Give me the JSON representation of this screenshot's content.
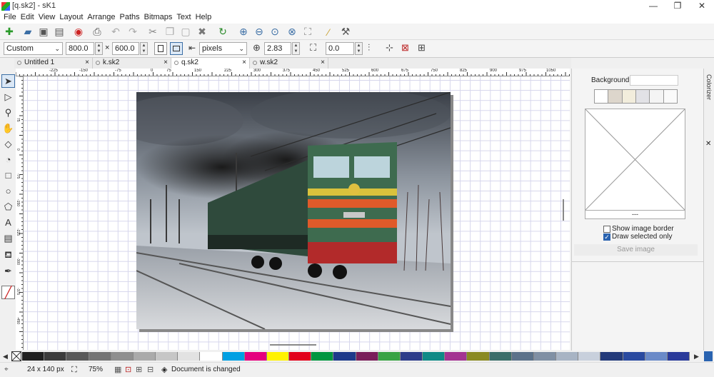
{
  "window": {
    "title": "[q.sk2] - sK1",
    "minimize": "—",
    "maximize": "❐",
    "close": "✕"
  },
  "menu": [
    "File",
    "Edit",
    "View",
    "Layout",
    "Arrange",
    "Paths",
    "Bitmaps",
    "Text",
    "Help"
  ],
  "toolbar": {
    "icons": [
      "new-document-icon",
      "open-folder-icon",
      "save-icon",
      "save-as-icon",
      "close-document-icon",
      "print-icon",
      "undo-icon",
      "redo-icon",
      "cut-icon",
      "copy-icon",
      "paste-icon",
      "delete-icon",
      "refresh-icon",
      "zoom-in-icon",
      "zoom-out-icon",
      "zoom-fit-icon",
      "zoom-selection-icon",
      "zoom-page-icon",
      "wand-icon",
      "pipette-icon"
    ]
  },
  "properties": {
    "page_format": "Custom",
    "width": "800.0",
    "height": "600.0",
    "times": "×",
    "units": "pixels",
    "jump": "2.83",
    "angle": "0.0"
  },
  "tabs": [
    {
      "label": "Untitled 1",
      "close": "×"
    },
    {
      "label": "k.sk2",
      "close": "×"
    },
    {
      "label": "q.sk2",
      "close": "×",
      "active": true
    },
    {
      "label": "w.sk2",
      "close": "×"
    }
  ],
  "ruler_h_ticks": [
    "-225",
    "-150",
    "-75",
    "0",
    "75",
    "150",
    "225",
    "300",
    "375",
    "450",
    "525",
    "600",
    "675",
    "750",
    "825",
    "900",
    "975",
    "1050"
  ],
  "ruler_v_ticks": [
    "75",
    "0",
    "-75",
    "-150",
    "-225",
    "-300",
    "-375",
    "-450",
    "-525",
    "-600",
    "-675"
  ],
  "left_tools": [
    "selection-arrow-icon",
    "node-edit-icon",
    "zoom-tool-icon",
    "fleur-hand-icon",
    "polyline-icon",
    "bezier-icon",
    "rectangle-icon",
    "ellipse-icon",
    "polygon-icon",
    "text-tool-icon",
    "gradient-tool-icon",
    "fill-bucket-icon",
    "pen-outline-icon",
    "no-fill-stroke-icon"
  ],
  "bitmap_panel": {
    "background_label": "Background:",
    "preview_caption": "---",
    "show_border_label": "Show image border",
    "show_border_checked": false,
    "draw_selected_label": "Draw selected only",
    "draw_selected_checked": true,
    "save_button": "Save image"
  },
  "side_tab": {
    "label": "Colorizer"
  },
  "palette": {
    "colors": [
      "#202020",
      "#3c3c3c",
      "#595959",
      "#747474",
      "#8f8f8f",
      "#aaaaaa",
      "#c6c6c6",
      "#e2e2e2",
      "#ffffff",
      "#00a0e3",
      "#e5007e",
      "#fff200",
      "#e2001a",
      "#009640",
      "#1e3a8a",
      "#7a1f5a",
      "#3aa345",
      "#2d3d8a",
      "#0f8a86",
      "#a43492",
      "#8a8a22",
      "#3b6e6a",
      "#5c728a",
      "#8090a4",
      "#a8b4c4",
      "#c8d0dc",
      "#233a7a",
      "#2a4aa0",
      "#6a8ac8",
      "#2a3a9a"
    ]
  },
  "status": {
    "dimensions": "24 x 140 px",
    "zoom": "75%",
    "message": "Document is changed"
  }
}
